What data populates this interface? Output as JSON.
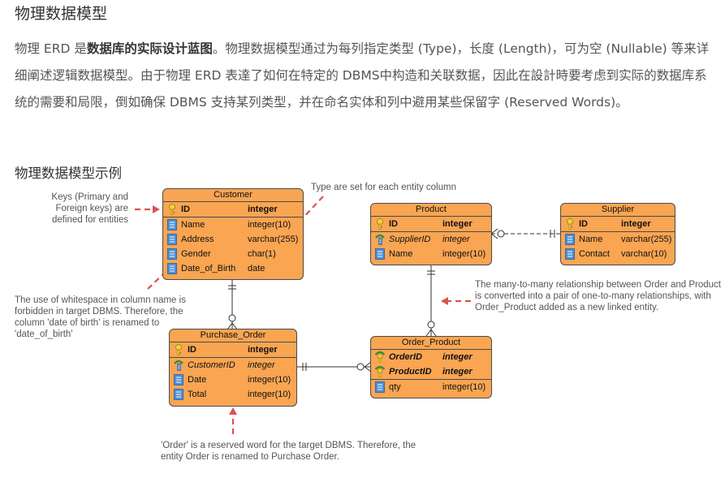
{
  "title": "物理数据模型",
  "intro": {
    "p1": "物理 ERD 是",
    "bold": "数据库的实际设计蓝图",
    "p2": "。物理数据模型通过为每列指定类型 (Type)，长度 (Length)，可为空 (Nullable) 等来详细阐述逻辑数据模型。由于物理 ERD 表達了如何在特定的 DBMS中构造和关联数据，因此在設計時要考虑到实际的数据库系统的需要和局限，倒如确保 DBMS 支持某列类型，并在命名实体和列中避用某些保留字 (Reserved Words)。"
  },
  "subtitle": "物理数据模型示例",
  "colors": {
    "entity_fill": "#f9a552",
    "arrow": "#d9534f",
    "border": "#4a4a4a"
  },
  "entities": {
    "customer": {
      "name": "Customer",
      "columns": [
        {
          "name": "ID",
          "type": "integer",
          "key": "pk"
        },
        {
          "name": "Name",
          "type": "integer(10)",
          "key": "none"
        },
        {
          "name": "Address",
          "type": "varchar(255)",
          "key": "none"
        },
        {
          "name": "Gender",
          "type": "char(1)",
          "key": "none"
        },
        {
          "name": "Date_of_Birth",
          "type": "date",
          "key": "none"
        }
      ]
    },
    "product": {
      "name": "Product",
      "columns": [
        {
          "name": "ID",
          "type": "integer",
          "key": "pk"
        },
        {
          "name": "SupplierID",
          "type": "integer",
          "key": "fk"
        },
        {
          "name": "Name",
          "type": "integer(10)",
          "key": "none"
        }
      ]
    },
    "supplier": {
      "name": "Supplier",
      "columns": [
        {
          "name": "ID",
          "type": "integer",
          "key": "pk"
        },
        {
          "name": "Name",
          "type": "varchar(255)",
          "key": "none"
        },
        {
          "name": "Contact",
          "type": "varchar(10)",
          "key": "none"
        }
      ]
    },
    "purchase_order": {
      "name": "Purchase_Order",
      "columns": [
        {
          "name": "ID",
          "type": "integer",
          "key": "pk"
        },
        {
          "name": "CustomerID",
          "type": "integer",
          "key": "fk"
        },
        {
          "name": "Date",
          "type": "integer(10)",
          "key": "none"
        },
        {
          "name": "Total",
          "type": "integer(10)",
          "key": "none"
        }
      ]
    },
    "order_product": {
      "name": "Order_Product",
      "columns": [
        {
          "name": "OrderID",
          "type": "integer",
          "key": "pkfk"
        },
        {
          "name": "ProductID",
          "type": "integer",
          "key": "pkfk"
        },
        {
          "name": "qty",
          "type": "integer(10)",
          "key": "none"
        }
      ]
    }
  },
  "annotations": {
    "keys": "Keys (Primary and Foreign keys) are defined for entities",
    "type": "Type are set for each entity column",
    "whitespace": "The use of whitespace in column name is forbidden in target DBMS. Therefore, the column 'date of birth' is renamed to 'date_of_birth'",
    "many_to_many": "The many-to-many relationship between Order and Product is converted into a pair of one-to-many relationships, with Order_Product added as a new linked entity.",
    "reserved": "'Order' is a reserved word for the target DBMS. Therefore, the entity Order is renamed to Purchase Order."
  }
}
